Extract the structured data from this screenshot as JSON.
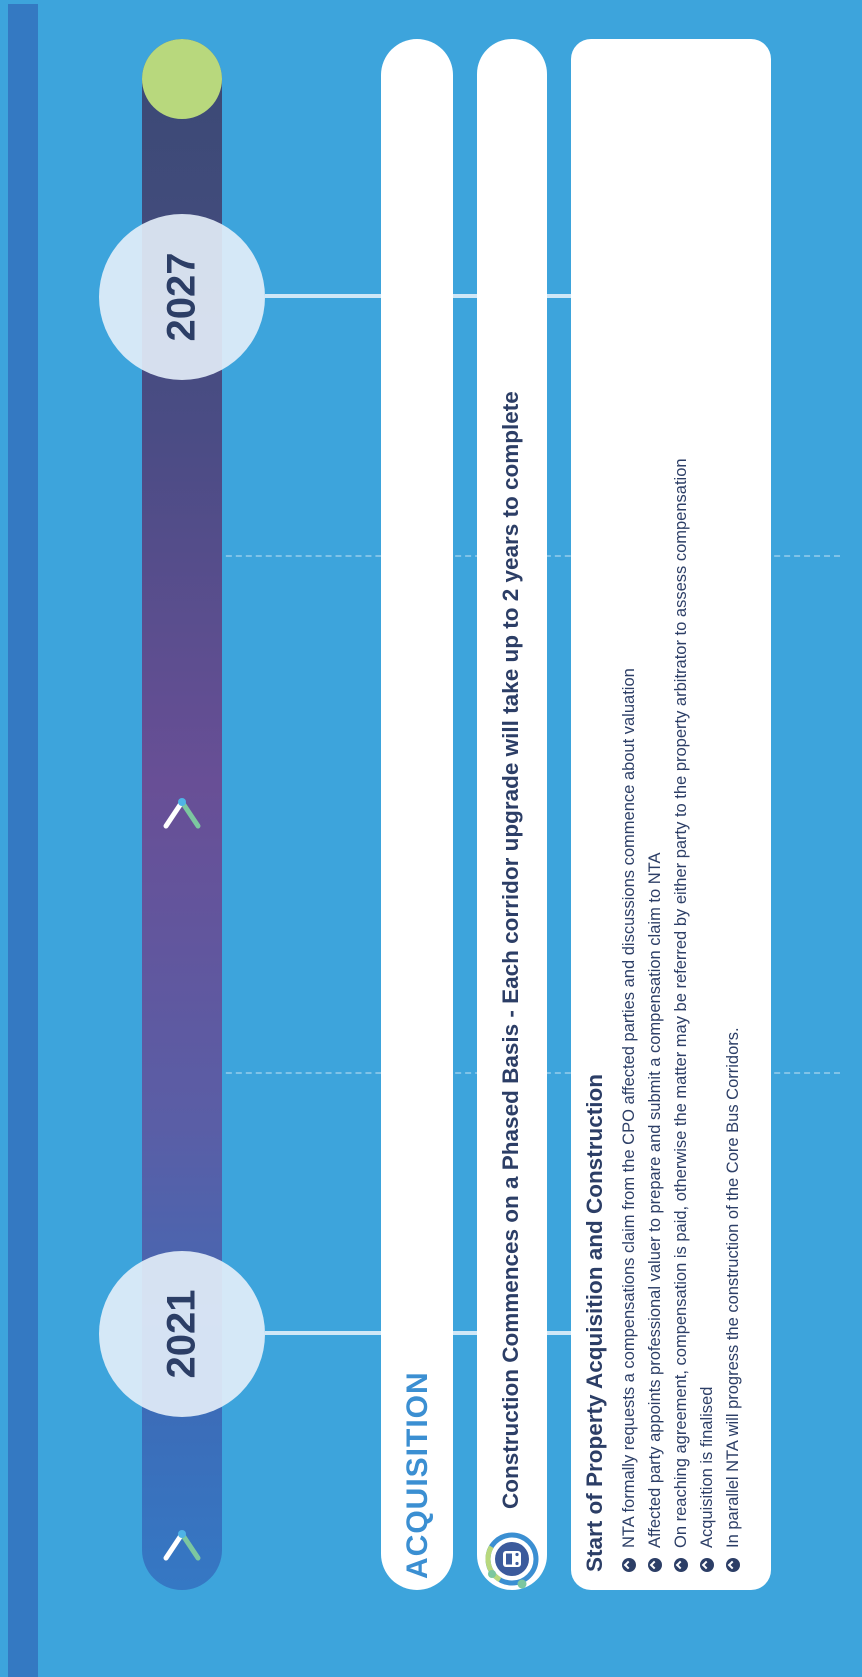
{
  "timeline": {
    "year_start": "2021",
    "year_end": "2027"
  },
  "acquisition_label": "ACQUISITION",
  "phase_banner": "Construction Commences on a Phased Basis - Each corridor upgrade will take up to 2 years to complete",
  "panel": {
    "title": "Start of Property Acquisition and Construction",
    "bullets": [
      "NTA formally requests a compensations claim from the CPO affected parties and discussions commence about valuation",
      "Affected party appoints professional valuer to prepare and submit a compensation claim to NTA",
      "On reaching agreement, compensation is paid, otherwise the matter may be referred by either party to the property arbitrator to assess compensation",
      "Acquisition is finalised",
      "In parallel NTA will progress the construction of the Core Bus Corridors."
    ]
  },
  "colors": {
    "background": "#3da4dc",
    "navy": "#2c3e66",
    "accent_green": "#b8d87d",
    "accent_blue": "#3b8fd2"
  },
  "icons": [
    "chevron-up-icon",
    "bus-icon",
    "bullet-chevron-icon"
  ]
}
